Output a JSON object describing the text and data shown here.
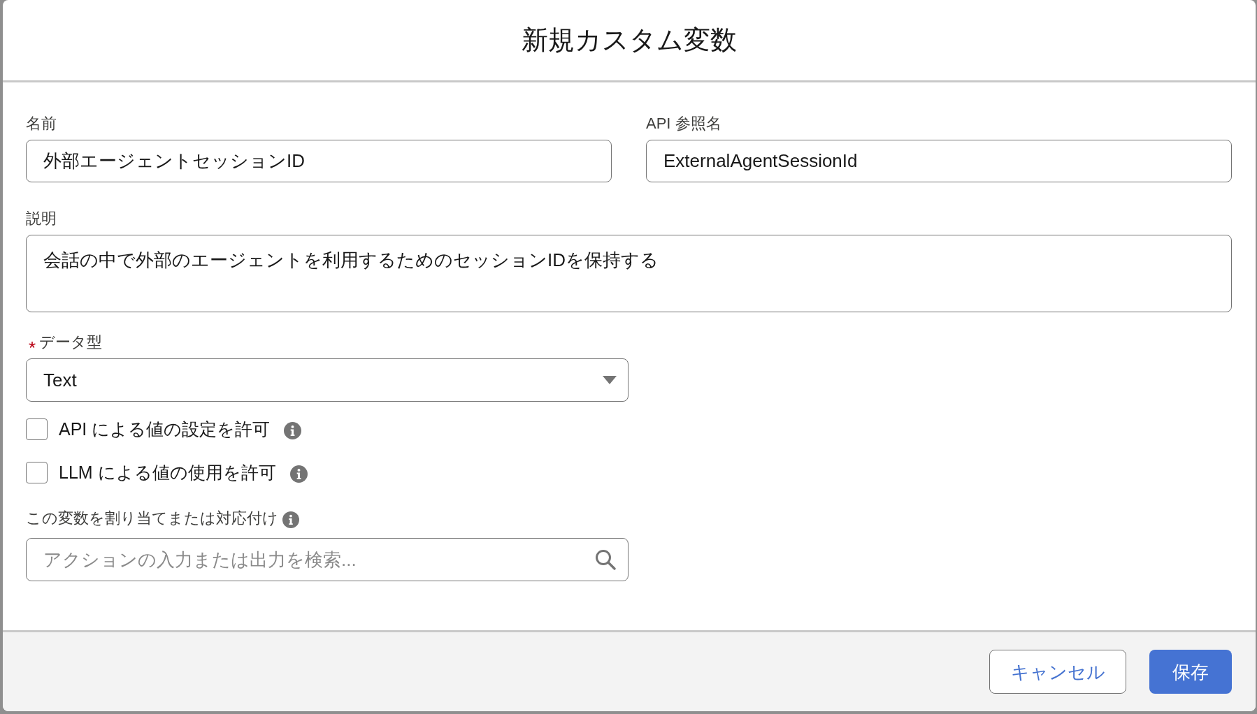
{
  "dialog": {
    "title": "新規カスタム変数"
  },
  "name_field": {
    "label": "名前",
    "value": "外部エージェントセッションID"
  },
  "api_name_field": {
    "label": "API 参照名",
    "value": "ExternalAgentSessionId"
  },
  "description_field": {
    "label": "説明",
    "value": "会話の中で外部のエージェントを利用するためのセッションIDを保持する"
  },
  "data_type_field": {
    "label": "データ型",
    "required": true,
    "value": "Text"
  },
  "options": [
    {
      "label": "API による値の設定を許可",
      "checked": false
    },
    {
      "label": "LLM による値の使用を許可",
      "checked": false
    }
  ],
  "mapping_field": {
    "label": "この変数を割り当てまたは対応付け",
    "placeholder": "アクションの入力または出力を検索..."
  },
  "buttons": [
    {
      "label": "キャンセル",
      "kind": "neutral"
    },
    {
      "label": "保存",
      "kind": "brand"
    }
  ]
}
